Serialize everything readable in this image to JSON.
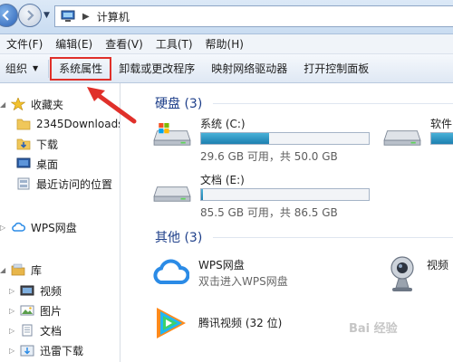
{
  "address": {
    "location": "计算机"
  },
  "menu": [
    "文件(F)",
    "编辑(E)",
    "查看(V)",
    "工具(T)",
    "帮助(H)"
  ],
  "toolbar": {
    "organize": "组织",
    "system_properties": "系统属性",
    "uninstall": "卸载或更改程序",
    "map_drive": "映射网络驱动器",
    "control_panel": "打开控制面板"
  },
  "navpane": {
    "favorites": "收藏夹",
    "downloads_folder": "2345Downloads",
    "downloads": "下载",
    "desktop": "桌面",
    "recent": "最近访问的位置",
    "wps": "WPS网盘",
    "libraries": "库",
    "videos": "视频",
    "pictures": "图片",
    "documents": "文档",
    "xunlei": "迅雷下载"
  },
  "groups": {
    "hdd_title": "硬盘 (3)",
    "other_title": "其他 (3)"
  },
  "drives": [
    {
      "name": "系统 (C:)",
      "info": "29.6 GB 可用，共 50.0 GB",
      "used_fraction": 0.408
    },
    {
      "name": "文档 (E:)",
      "info": "85.5 GB 可用，共 86.5 GB",
      "used_fraction": 0.012
    },
    {
      "name": "软件"
    }
  ],
  "other": [
    {
      "name": "WPS网盘",
      "sub": "双击进入WPS网盘"
    },
    {
      "name": "腾讯视频 (32 位)"
    },
    {
      "name": "视频"
    }
  ],
  "colors": {
    "highlight": "#e0302a",
    "group_title": "#1e3f8a",
    "drive_fill": "#1c80b0"
  },
  "watermark": "Bai 经验"
}
